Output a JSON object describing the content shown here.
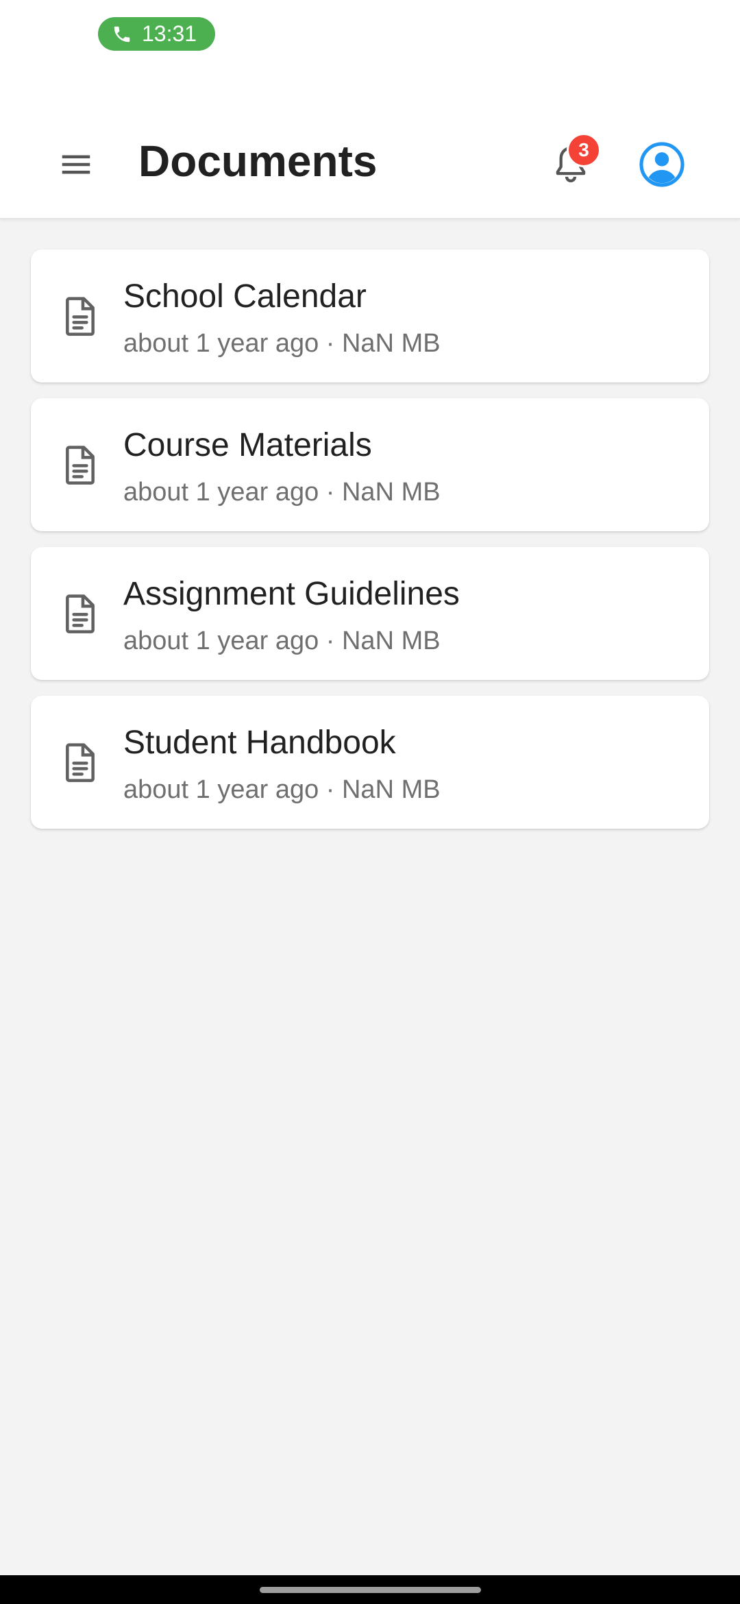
{
  "status_bar": {
    "call_time": "13:31",
    "call_icon": "phone-icon",
    "pill_color": "#4caf50"
  },
  "app_bar": {
    "title": "Documents",
    "menu_icon": "hamburger-menu-icon",
    "notifications": {
      "icon": "bell-icon",
      "badge_count": "3",
      "badge_color": "#f44336"
    },
    "profile": {
      "icon": "account-circle-icon",
      "color": "#2196f3"
    }
  },
  "documents": [
    {
      "title": "School Calendar",
      "meta": "about 1 year ago · NaN MB",
      "icon": "document-icon"
    },
    {
      "title": "Course Materials",
      "meta": "about 1 year ago · NaN MB",
      "icon": "document-icon"
    },
    {
      "title": "Assignment Guidelines",
      "meta": "about 1 year ago · NaN MB",
      "icon": "document-icon"
    },
    {
      "title": "Student Handbook",
      "meta": "about 1 year ago · NaN MB",
      "icon": "document-icon"
    }
  ]
}
